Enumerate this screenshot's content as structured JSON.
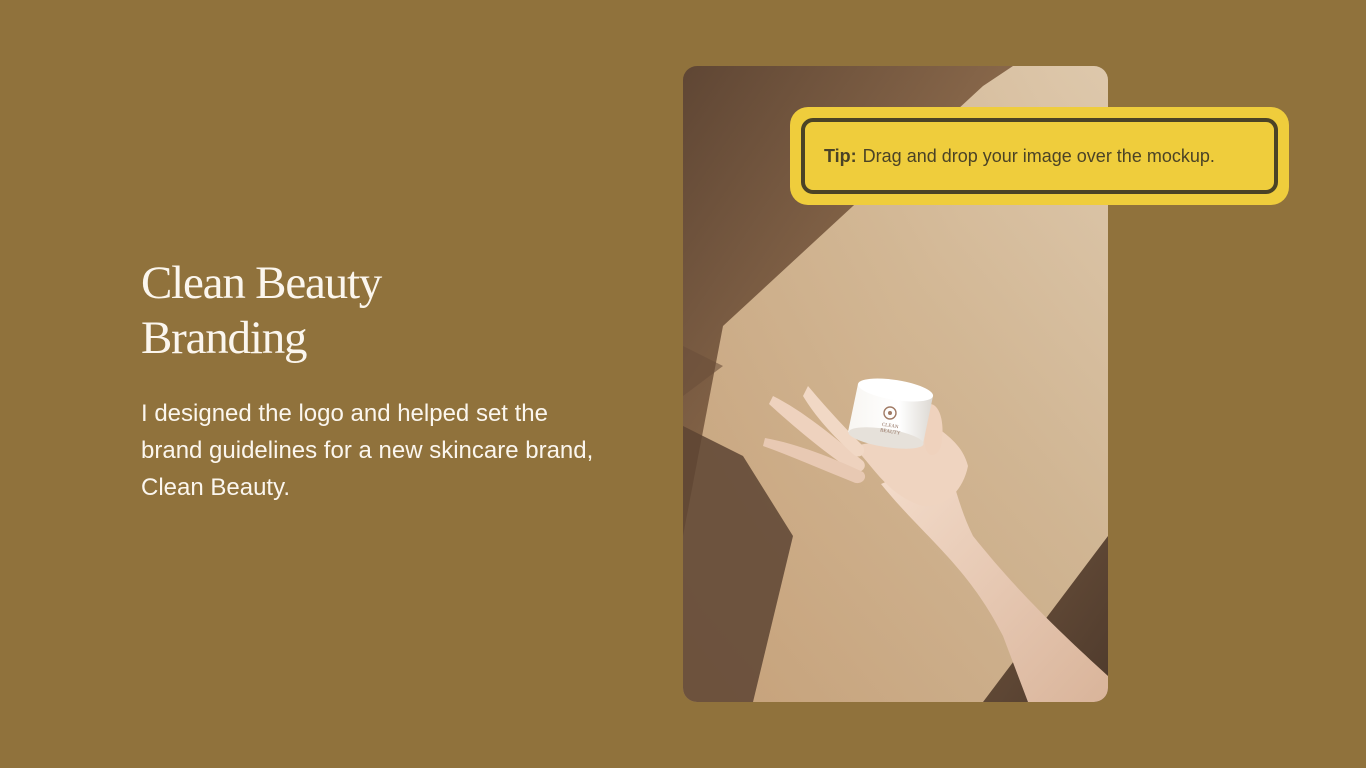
{
  "slide": {
    "title_lines": [
      "Clean Beauty",
      "Branding"
    ],
    "description": "I designed the logo and helped set the brand guidelines for a new skincare brand, Clean Beauty.",
    "mockup": {
      "image_icon": "hand-holding-cream-jar-photo",
      "jar_label_lines": [
        "CLEAN",
        "BEAUTY"
      ]
    }
  },
  "tip": {
    "label": "Tip:",
    "text": "Drag and drop your image over the mockup."
  },
  "colors": {
    "background": "#90723c",
    "title_text": "#fbf6ee",
    "tip_fill": "#efcd3c",
    "tip_border": "#4b4326"
  }
}
